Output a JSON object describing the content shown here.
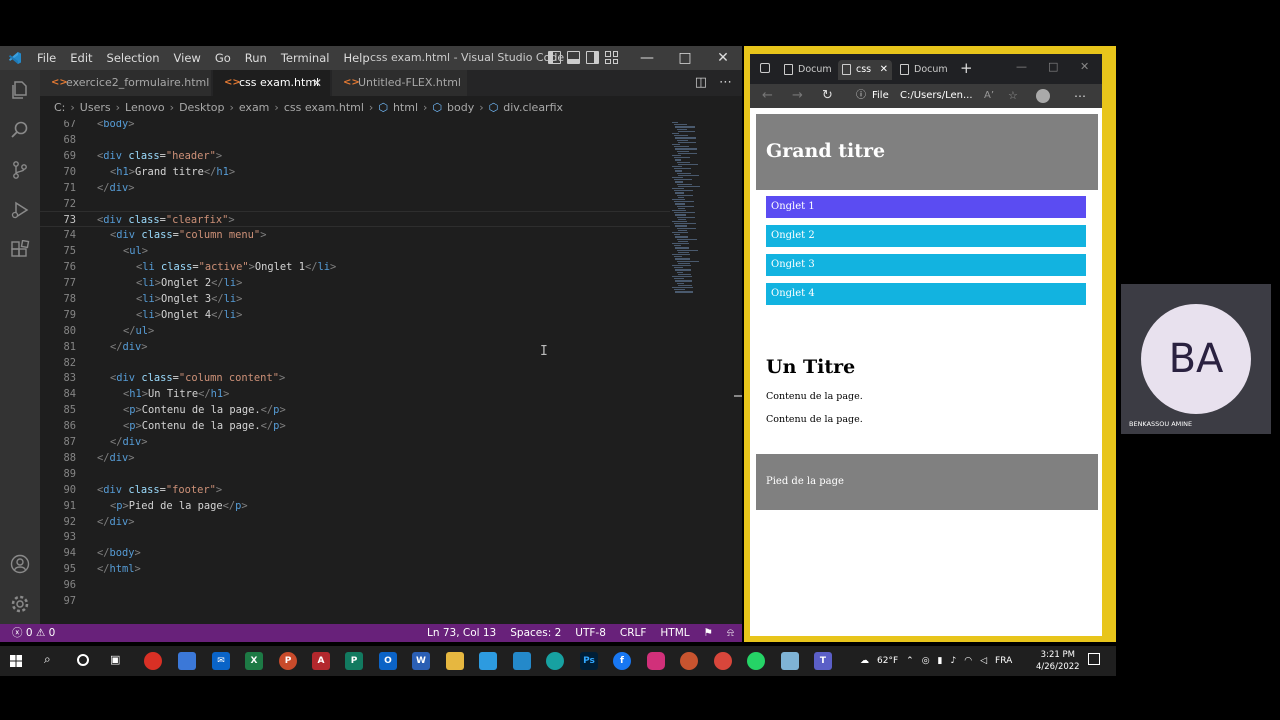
{
  "vscode": {
    "menu": [
      "File",
      "Edit",
      "Selection",
      "View",
      "Go",
      "Run",
      "Terminal",
      "Help"
    ],
    "title": "css exam.html - Visual Studio Code",
    "tabs": [
      {
        "label": "exercice2_formulaire.html",
        "icon": "<>"
      },
      {
        "label": "css exam.html",
        "icon": "<>",
        "close": "✕"
      },
      {
        "label": "Untitled-FLEX.html",
        "icon": "<>"
      }
    ],
    "breadcrumb": [
      "C:",
      "Users",
      "Lenovo",
      "Desktop",
      "exam",
      "css exam.html",
      "html",
      "body",
      "div.clearfix"
    ],
    "code_lines": [
      {
        "n": "67",
        "tokens": [
          [
            "br",
            "<"
          ],
          [
            "tag",
            "body"
          ],
          [
            "br",
            ">"
          ]
        ],
        "indent": 0
      },
      {
        "n": "68",
        "tokens": [],
        "indent": 0
      },
      {
        "n": "69",
        "tokens": [
          [
            "br",
            "<"
          ],
          [
            "tag",
            "div"
          ],
          [
            "txt",
            " "
          ],
          [
            "attr",
            "class"
          ],
          [
            "eq",
            "="
          ],
          [
            "str",
            "\"header\""
          ],
          [
            "br",
            ">"
          ]
        ],
        "indent": 0
      },
      {
        "n": "70",
        "tokens": [
          [
            "br",
            "<"
          ],
          [
            "tag",
            "h1"
          ],
          [
            "br",
            ">"
          ],
          [
            "txt",
            "Grand titre"
          ],
          [
            "br",
            "</"
          ],
          [
            "tag",
            "h1"
          ],
          [
            "br",
            ">"
          ]
        ],
        "indent": 1
      },
      {
        "n": "71",
        "tokens": [
          [
            "br",
            "</"
          ],
          [
            "tag",
            "div"
          ],
          [
            "br",
            ">"
          ]
        ],
        "indent": 0
      },
      {
        "n": "72",
        "tokens": [],
        "indent": 0
      },
      {
        "n": "73",
        "tokens": [
          [
            "br",
            "<"
          ],
          [
            "tag",
            "div"
          ],
          [
            "txt",
            " "
          ],
          [
            "attr",
            "class"
          ],
          [
            "eq",
            "="
          ],
          [
            "str",
            "\"clearfix\""
          ],
          [
            "br",
            ">"
          ]
        ],
        "indent": 0
      },
      {
        "n": "74",
        "tokens": [
          [
            "br",
            "<"
          ],
          [
            "tag",
            "div"
          ],
          [
            "txt",
            " "
          ],
          [
            "attr",
            "class"
          ],
          [
            "eq",
            "="
          ],
          [
            "str",
            "\"column menu\""
          ],
          [
            "br",
            ">"
          ]
        ],
        "indent": 1
      },
      {
        "n": "75",
        "tokens": [
          [
            "br",
            "<"
          ],
          [
            "tag",
            "ul"
          ],
          [
            "br",
            ">"
          ]
        ],
        "indent": 2
      },
      {
        "n": "76",
        "tokens": [
          [
            "br",
            "<"
          ],
          [
            "tag",
            "li"
          ],
          [
            "txt",
            " "
          ],
          [
            "attr",
            "class"
          ],
          [
            "eq",
            "="
          ],
          [
            "str",
            "\"active\""
          ],
          [
            "br",
            ">"
          ],
          [
            "txt",
            "Onglet 1"
          ],
          [
            "br",
            "</"
          ],
          [
            "tag",
            "li"
          ],
          [
            "br",
            ">"
          ]
        ],
        "indent": 3
      },
      {
        "n": "77",
        "tokens": [
          [
            "br",
            "<"
          ],
          [
            "tag",
            "li"
          ],
          [
            "br",
            ">"
          ],
          [
            "txt",
            "Onglet 2"
          ],
          [
            "br",
            "</"
          ],
          [
            "tag",
            "li"
          ],
          [
            "br",
            ">"
          ]
        ],
        "indent": 3
      },
      {
        "n": "78",
        "tokens": [
          [
            "br",
            "<"
          ],
          [
            "tag",
            "li"
          ],
          [
            "br",
            ">"
          ],
          [
            "txt",
            "Onglet 3"
          ],
          [
            "br",
            "</"
          ],
          [
            "tag",
            "li"
          ],
          [
            "br",
            ">"
          ]
        ],
        "indent": 3
      },
      {
        "n": "79",
        "tokens": [
          [
            "br",
            "<"
          ],
          [
            "tag",
            "li"
          ],
          [
            "br",
            ">"
          ],
          [
            "txt",
            "Onglet 4"
          ],
          [
            "br",
            "</"
          ],
          [
            "tag",
            "li"
          ],
          [
            "br",
            ">"
          ]
        ],
        "indent": 3
      },
      {
        "n": "80",
        "tokens": [
          [
            "br",
            "</"
          ],
          [
            "tag",
            "ul"
          ],
          [
            "br",
            ">"
          ]
        ],
        "indent": 2
      },
      {
        "n": "81",
        "tokens": [
          [
            "br",
            "</"
          ],
          [
            "tag",
            "div"
          ],
          [
            "br",
            ">"
          ]
        ],
        "indent": 1
      },
      {
        "n": "82",
        "tokens": [],
        "indent": 0
      },
      {
        "n": "83",
        "tokens": [
          [
            "br",
            "<"
          ],
          [
            "tag",
            "div"
          ],
          [
            "txt",
            " "
          ],
          [
            "attr",
            "class"
          ],
          [
            "eq",
            "="
          ],
          [
            "str",
            "\"column content\""
          ],
          [
            "br",
            ">"
          ]
        ],
        "indent": 1
      },
      {
        "n": "84",
        "tokens": [
          [
            "br",
            "<"
          ],
          [
            "tag",
            "h1"
          ],
          [
            "br",
            ">"
          ],
          [
            "txt",
            "Un Titre"
          ],
          [
            "br",
            "</"
          ],
          [
            "tag",
            "h1"
          ],
          [
            "br",
            ">"
          ]
        ],
        "indent": 2
      },
      {
        "n": "85",
        "tokens": [
          [
            "br",
            "<"
          ],
          [
            "tag",
            "p"
          ],
          [
            "br",
            ">"
          ],
          [
            "txt",
            "Contenu de la page."
          ],
          [
            "br",
            "</"
          ],
          [
            "tag",
            "p"
          ],
          [
            "br",
            ">"
          ]
        ],
        "indent": 2
      },
      {
        "n": "86",
        "tokens": [
          [
            "br",
            "<"
          ],
          [
            "tag",
            "p"
          ],
          [
            "br",
            ">"
          ],
          [
            "txt",
            "Contenu de la page."
          ],
          [
            "br",
            "</"
          ],
          [
            "tag",
            "p"
          ],
          [
            "br",
            ">"
          ]
        ],
        "indent": 2
      },
      {
        "n": "87",
        "tokens": [
          [
            "br",
            "</"
          ],
          [
            "tag",
            "div"
          ],
          [
            "br",
            ">"
          ]
        ],
        "indent": 1
      },
      {
        "n": "88",
        "tokens": [
          [
            "br",
            "</"
          ],
          [
            "tag",
            "div"
          ],
          [
            "br",
            ">"
          ]
        ],
        "indent": 0
      },
      {
        "n": "89",
        "tokens": [],
        "indent": 0
      },
      {
        "n": "90",
        "tokens": [
          [
            "br",
            "<"
          ],
          [
            "tag",
            "div"
          ],
          [
            "txt",
            " "
          ],
          [
            "attr",
            "class"
          ],
          [
            "eq",
            "="
          ],
          [
            "str",
            "\"footer\""
          ],
          [
            "br",
            ">"
          ]
        ],
        "indent": 0
      },
      {
        "n": "91",
        "tokens": [
          [
            "br",
            "<"
          ],
          [
            "tag",
            "p"
          ],
          [
            "br",
            ">"
          ],
          [
            "txt",
            "Pied de la page"
          ],
          [
            "br",
            "</"
          ],
          [
            "tag",
            "p"
          ],
          [
            "br",
            ">"
          ]
        ],
        "indent": 1
      },
      {
        "n": "92",
        "tokens": [
          [
            "br",
            "</"
          ],
          [
            "tag",
            "div"
          ],
          [
            "br",
            ">"
          ]
        ],
        "indent": 0
      },
      {
        "n": "93",
        "tokens": [],
        "indent": 0
      },
      {
        "n": "94",
        "tokens": [
          [
            "br",
            "</"
          ],
          [
            "tag",
            "body"
          ],
          [
            "br",
            ">"
          ]
        ],
        "indent": 0
      },
      {
        "n": "95",
        "tokens": [
          [
            "br",
            "</"
          ],
          [
            "tag",
            "html"
          ],
          [
            "br",
            ">"
          ]
        ],
        "indent": 0
      },
      {
        "n": "96",
        "tokens": [],
        "indent": 0
      },
      {
        "n": "97",
        "tokens": [],
        "indent": 0
      }
    ],
    "current_line": "73",
    "status": {
      "problems": "ⓧ 0 ⚠ 0",
      "position": "Ln 73, Col 13",
      "spaces": "Spaces: 2",
      "encoding": "UTF-8",
      "eol": "CRLF",
      "language": "HTML"
    },
    "colors": {
      "status_bar": "#68217a",
      "editor_bg": "#1e1e1e"
    }
  },
  "browser": {
    "tabs": [
      {
        "label": "Docum"
      },
      {
        "label": "css",
        "close": "✕"
      },
      {
        "label": "Docum"
      }
    ],
    "new_tab": "+",
    "address_prefix": "File",
    "url": "C:/Users/Len...",
    "page": {
      "header_title": "Grand titre",
      "menu_items": [
        "Onglet 1",
        "Onglet 2",
        "Onglet 3",
        "Onglet 4"
      ],
      "content_title": "Un Titre",
      "paragraphs": [
        "Contenu de la page.",
        "Contenu de la page."
      ],
      "footer": "Pied de la page"
    },
    "colors": {
      "header_bg": "#808080",
      "active_item": "#5b4cf2",
      "item": "#12b3e0",
      "frame": "#e8c51b"
    }
  },
  "participant": {
    "initials": "BA",
    "name": "BENKASSOU AMINE"
  },
  "taskbar": {
    "weather": "62°F",
    "language": "FRA",
    "time": "3:21 PM",
    "date": "4/26/2022"
  }
}
